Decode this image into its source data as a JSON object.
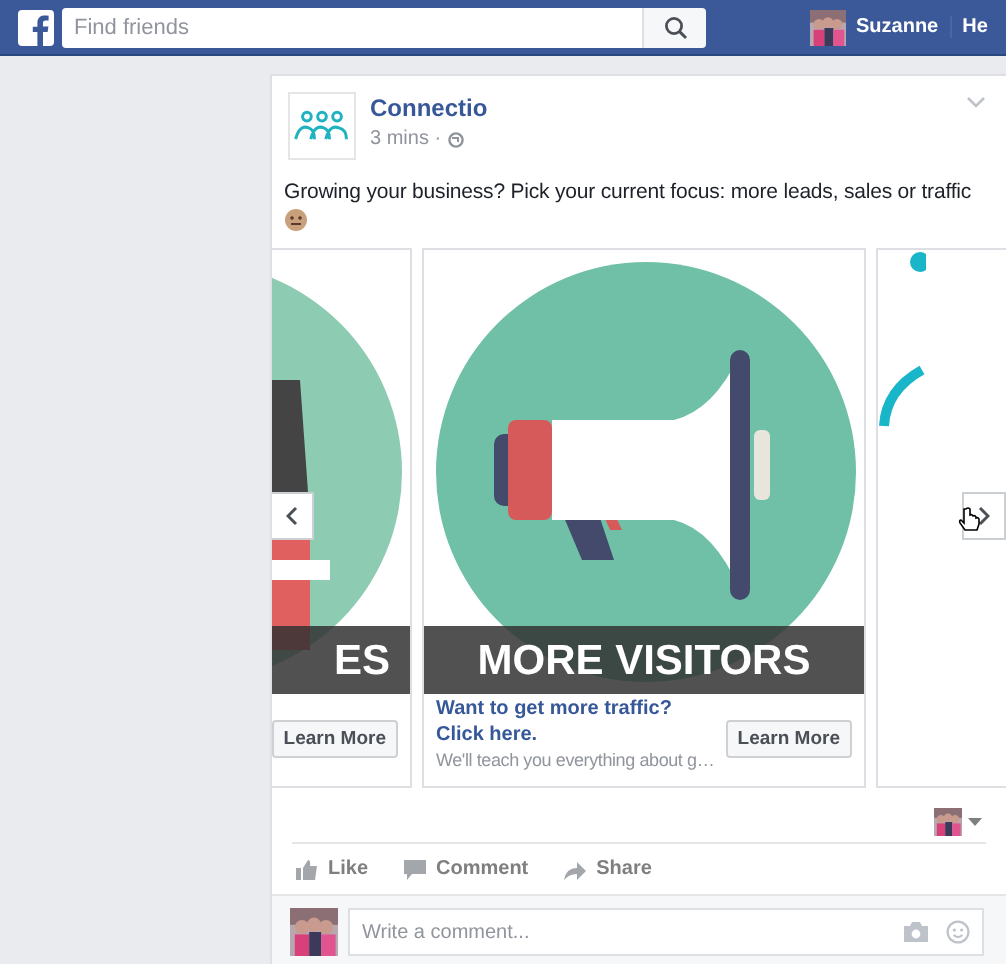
{
  "topbar": {
    "search": {
      "placeholder": "Find friends"
    },
    "user_name": "Suzanne",
    "nav_cut": "He"
  },
  "post": {
    "author": "Connectio",
    "time": "3 mins ·",
    "text": "Growing your business? Pick your current focus: more leads, sales or traffic",
    "carousel": [
      {
        "kind": "sales",
        "caption": "ES",
        "button": "Learn More"
      },
      {
        "kind": "megaphone",
        "caption": "MORE VISITORS",
        "headline": "Want to get more traffic? Click here.",
        "description": "We'll teach you everything about g…",
        "button": "Learn More"
      },
      {
        "kind": "blank"
      }
    ],
    "actions": [
      {
        "kind": "like",
        "label": "Like"
      },
      {
        "kind": "comment",
        "label": "Comment"
      },
      {
        "kind": "share",
        "label": "Share"
      }
    ],
    "comment": {
      "placeholder": "Write a comment..."
    }
  }
}
